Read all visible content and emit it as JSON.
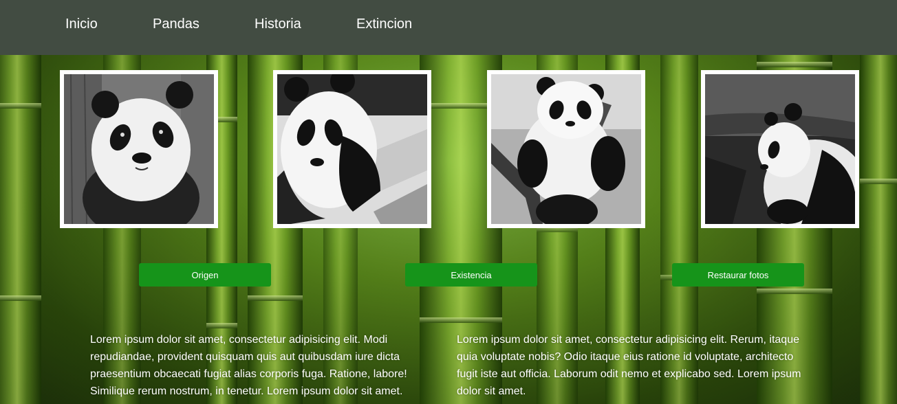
{
  "nav": {
    "items": [
      {
        "label": "Inicio"
      },
      {
        "label": "Pandas"
      },
      {
        "label": "Historia"
      },
      {
        "label": "Extincion"
      }
    ]
  },
  "gallery": {
    "photos": [
      {
        "subject": "panda-face"
      },
      {
        "subject": "panda-cub-on-log"
      },
      {
        "subject": "panda-cub-in-tree"
      },
      {
        "subject": "panda-sitting"
      }
    ]
  },
  "buttons": {
    "origen": "Origen",
    "existencia": "Existencia",
    "restaurar": "Restaurar fotos"
  },
  "content": {
    "paragraph_left": "Lorem ipsum dolor sit amet, consectetur adipisicing elit. Modi repudiandae, provident quisquam quis aut quibusdam iure dicta praesentium obcaecati fugiat alias corporis fuga. Ratione, labore! Similique rerum nostrum, in tenetur. Lorem ipsum dolor sit amet.",
    "paragraph_right": "Lorem ipsum dolor sit amet, consectetur adipisicing elit. Rerum, itaque quia voluptate nobis? Odio itaque eius ratione id voluptate, architecto fugit iste aut officia. Laborum odit nemo et explicabo sed. Lorem ipsum dolor sit amet."
  },
  "colors": {
    "nav_bg": "#424c42",
    "button_bg": "#16941a",
    "text": "#ffffff"
  }
}
